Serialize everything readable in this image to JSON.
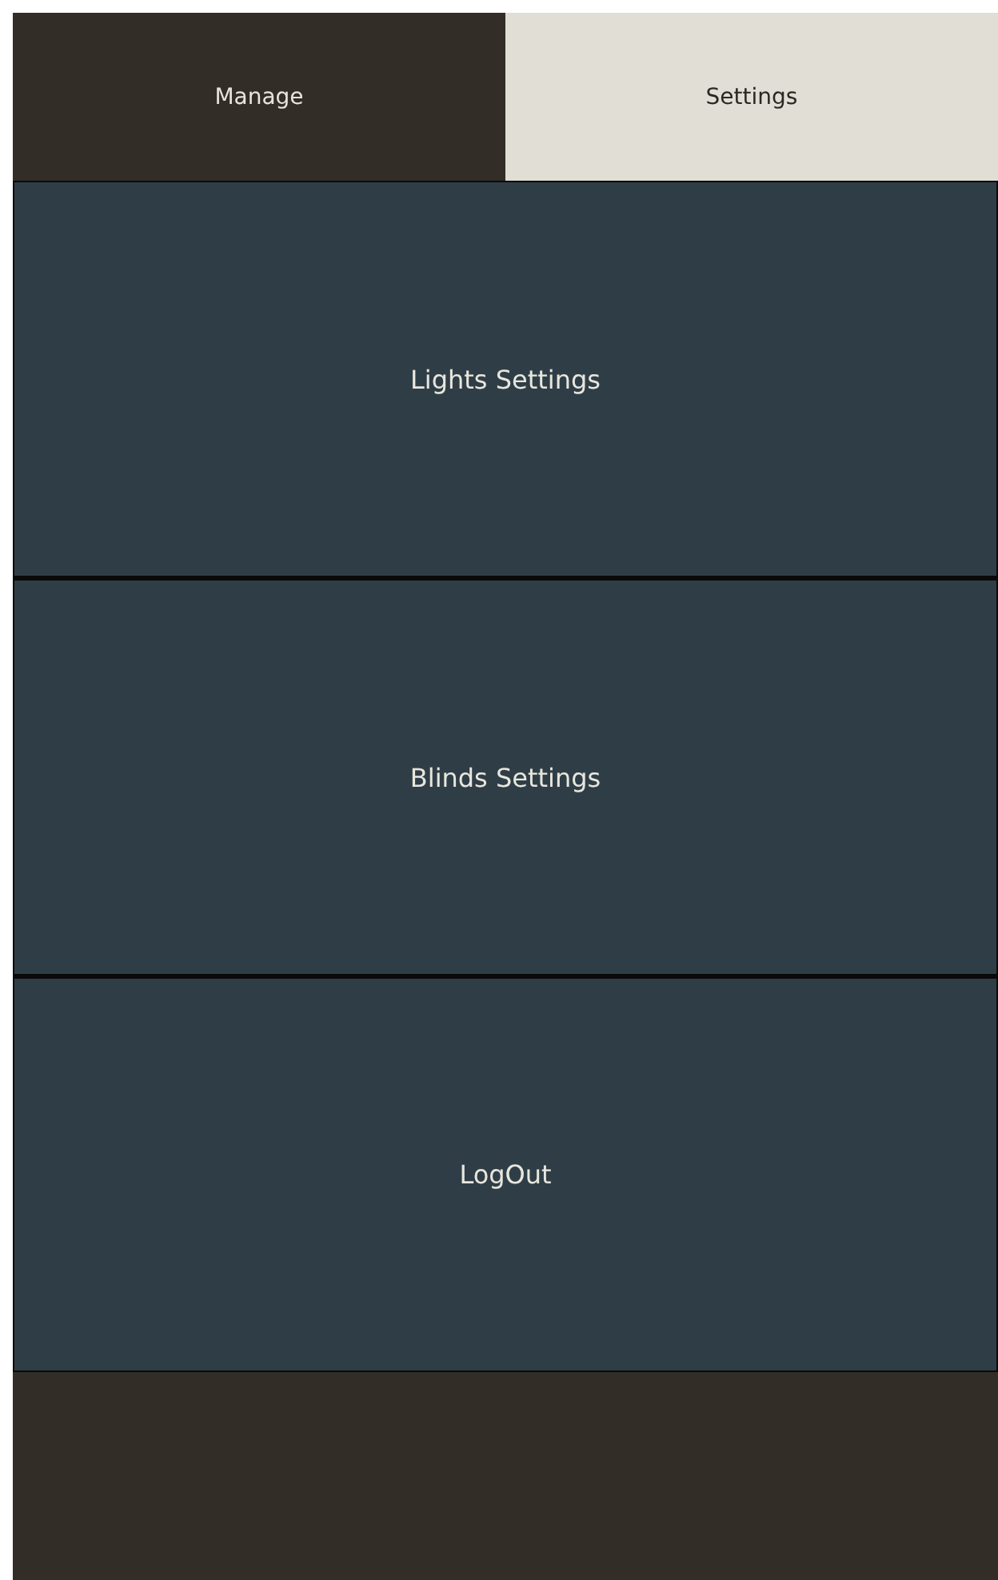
{
  "tabs": [
    {
      "label": "Manage",
      "selected": false
    },
    {
      "label": "Settings",
      "selected": true
    }
  ],
  "menu": [
    {
      "label": "Lights Settings"
    },
    {
      "label": "Blinds Settings"
    },
    {
      "label": "LogOut"
    }
  ]
}
